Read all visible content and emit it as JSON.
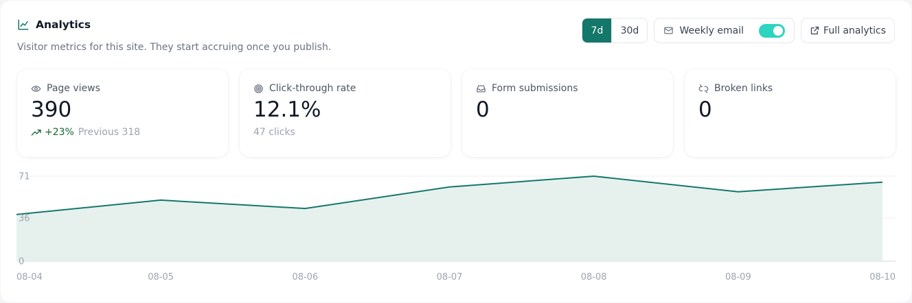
{
  "header": {
    "title": "Analytics",
    "subtitle": "Visitor metrics for this site. They start accruing once you publish."
  },
  "controls": {
    "range_options": [
      "7d",
      "30d"
    ],
    "selected_range": "7d",
    "weekly_email_label": "Weekly email",
    "weekly_email_enabled": true,
    "full_analytics_label": "Full analytics"
  },
  "stats": {
    "page_views": {
      "label": "Page views",
      "value": "390",
      "delta": "+23%",
      "previous": "Previous 318"
    },
    "ctr": {
      "label": "Click-through rate",
      "value": "12.1%",
      "sub": "47 clicks"
    },
    "forms": {
      "label": "Form submissions",
      "value": "0"
    },
    "broken": {
      "label": "Broken links",
      "value": "0"
    }
  },
  "colors": {
    "accent": "#13776a",
    "toggle_on": "#2dd4bf",
    "line": "#13776a",
    "area_fill": "#e6f1ee"
  },
  "chart_data": {
    "type": "area",
    "x": [
      "08-04",
      "08-05",
      "08-06",
      "08-07",
      "08-08",
      "08-09",
      "08-10"
    ],
    "values": [
      39,
      51,
      44,
      62,
      71,
      58,
      66
    ],
    "ylim": [
      0,
      71
    ],
    "yticks": [
      "0",
      "36",
      "71"
    ],
    "grid": true,
    "title": "",
    "xlabel": "",
    "ylabel": ""
  }
}
